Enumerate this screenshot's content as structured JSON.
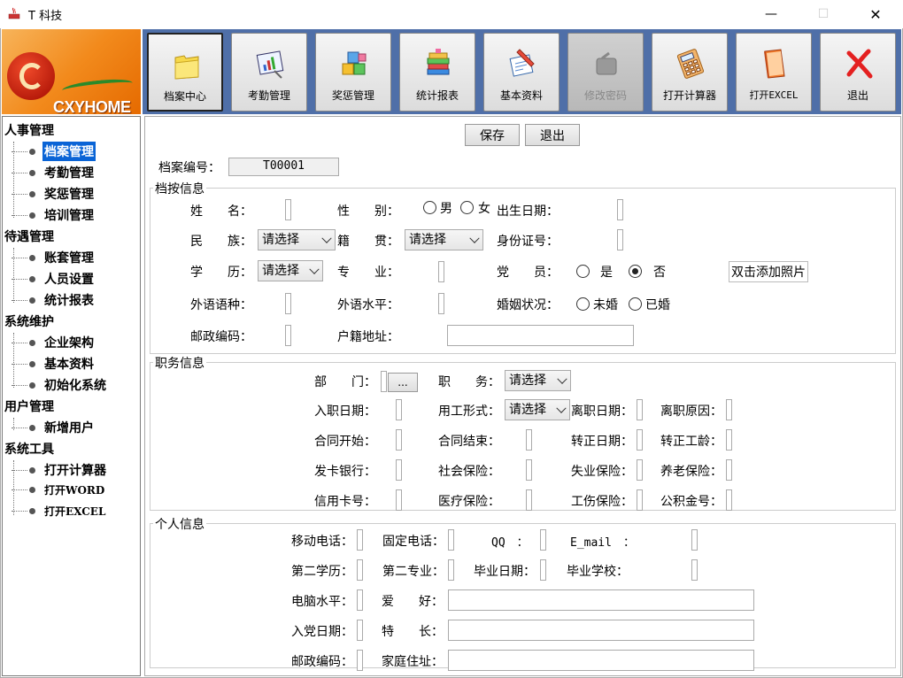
{
  "window": {
    "title": "T 科技",
    "minimize": "—",
    "maximize": "☐",
    "close": "✕"
  },
  "logo": {
    "text": "CXYHOME"
  },
  "toolbar": [
    {
      "label": "档案中心",
      "icon": "folder-icon",
      "state": "active"
    },
    {
      "label": "考勤管理",
      "icon": "chart-icon",
      "state": "normal"
    },
    {
      "label": "奖惩管理",
      "icon": "cubes-icon",
      "state": "normal"
    },
    {
      "label": "统计报表",
      "icon": "books-icon",
      "state": "normal"
    },
    {
      "label": "基本资料",
      "icon": "pen-paper-icon",
      "state": "normal"
    },
    {
      "label": "修改密码",
      "icon": "key-icon",
      "state": "disabled"
    },
    {
      "label": "打开计算器",
      "icon": "calculator-icon",
      "state": "normal"
    },
    {
      "label": "打开EXCEL",
      "icon": "excel-book-icon",
      "state": "normal"
    },
    {
      "label": "退出",
      "icon": "red-x-icon",
      "state": "normal"
    }
  ],
  "tree": {
    "groups": [
      {
        "label": "人事管理",
        "items": [
          "档案管理",
          "考勤管理",
          "奖惩管理",
          "培训管理"
        ]
      },
      {
        "label": "待遇管理",
        "items": [
          "账套管理",
          "人员设置",
          "统计报表"
        ]
      },
      {
        "label": "系统维护",
        "items": [
          "企业架构",
          "基本资料",
          "初始化系统"
        ]
      },
      {
        "label": "用户管理",
        "items": [
          "新增用户"
        ]
      },
      {
        "label": "系统工具",
        "items": [
          "打开计算器",
          "打开WORD",
          "打开EXCEL"
        ]
      }
    ],
    "selected": "档案管理"
  },
  "actions": {
    "save": "保存",
    "exit": "退出"
  },
  "form": {
    "record_no_label": "档案编号：",
    "record_no_value": "T00001",
    "sections": {
      "basic": "档按信息",
      "job": "职务信息",
      "personal": "个人信息"
    },
    "basic": {
      "name": "姓　　名：",
      "gender": "性　　别：",
      "male": "男",
      "female": "女",
      "birth": "出生日期：",
      "ethnic": "民　　族：",
      "native": "籍　　贯：",
      "idcard": "身份证号：",
      "edu": "学　　历：",
      "major": "专　　业：",
      "party": "党　　员：",
      "yes": "是",
      "no": "否",
      "photo": "双击添加照片",
      "lang": "外语语种：",
      "lang_level": "外语水平：",
      "marital": "婚姻状况：",
      "unmarried": "未婚",
      "married": "已婚",
      "postcode": "邮政编码：",
      "household": "户籍地址：",
      "select_placeholder": "请选择"
    },
    "job": {
      "dept": "部　　门：",
      "dots": "...",
      "position": "职　　务：",
      "hire": "入职日期：",
      "emp_type": "用工形式：",
      "leave_date": "离职日期：",
      "leave_reason": "离职原因：",
      "contract_start": "合同开始：",
      "contract_end": "合同结束：",
      "regular_date": "转正日期：",
      "regular_years": "转正工龄：",
      "bank": "发卡银行：",
      "social": "社会保险：",
      "unemploy": "失业保险：",
      "pension": "养老保险：",
      "credit": "信用卡号：",
      "medical": "医疗保险：",
      "injury": "工伤保险：",
      "fund": "公积金号：",
      "select_placeholder": "请选择"
    },
    "personal": {
      "mobile": "移动电话：",
      "phone": "固定电话：",
      "qq": "QQ　：",
      "email": "E_mail　：",
      "second_edu": "第二学历：",
      "second_major": "第二专业：",
      "grad_date": "毕业日期：",
      "grad_school": "毕业学校：",
      "computer": "电脑水平：",
      "hobby": "爱　　好：",
      "party_date": "入党日期：",
      "specialty": "特　　长：",
      "postcode": "邮政编码：",
      "home": "家庭住址："
    }
  }
}
